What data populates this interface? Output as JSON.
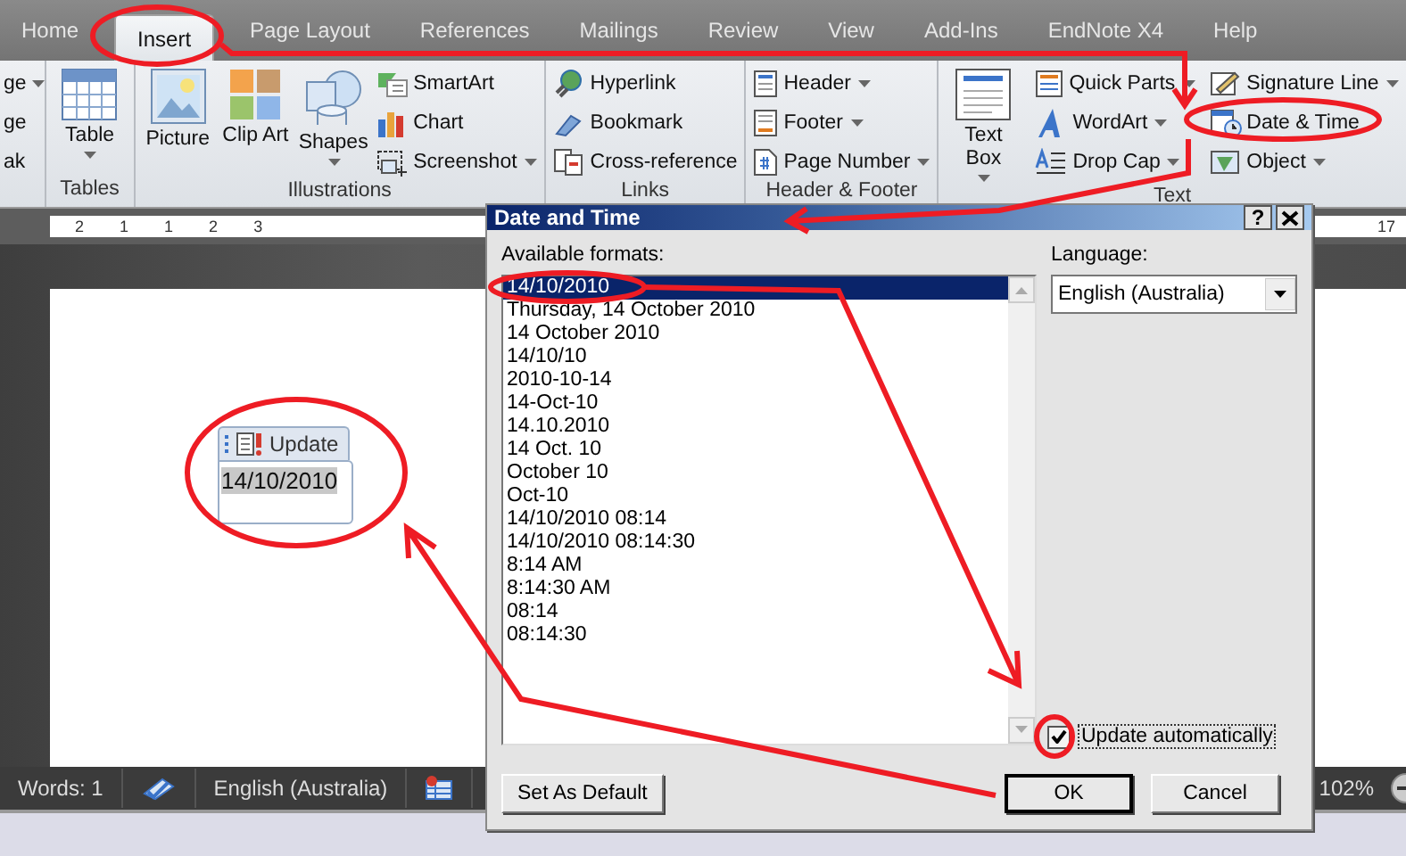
{
  "ribbon_tabs": [
    {
      "label": "Home",
      "selected": false
    },
    {
      "label": "Insert",
      "selected": true
    },
    {
      "label": "Page Layout",
      "selected": false
    },
    {
      "label": "References",
      "selected": false
    },
    {
      "label": "Mailings",
      "selected": false
    },
    {
      "label": "Review",
      "selected": false
    },
    {
      "label": "View",
      "selected": false
    },
    {
      "label": "Add-Ins",
      "selected": false
    },
    {
      "label": "EndNote X4",
      "selected": false
    },
    {
      "label": "Help",
      "selected": false
    }
  ],
  "ribbon_groups": [
    {
      "items": [
        {
          "kind": "column",
          "items": [
            {
              "label": "ge",
              "dropdown": true
            },
            {
              "label": "ge",
              "dropdown": false
            },
            {
              "label": "ak",
              "dropdown": false
            }
          ]
        }
      ]
    },
    {
      "label": "Tables",
      "items": [
        {
          "kind": "large",
          "label": "Table",
          "dropdown": true
        }
      ]
    },
    {
      "label": "Illustrations",
      "items": [
        {
          "kind": "large",
          "label": "Picture",
          "dropdown": false
        },
        {
          "kind": "large",
          "label": "Clip Art",
          "dropdown": false
        },
        {
          "kind": "large",
          "label": "Shapes",
          "dropdown": true
        },
        {
          "kind": "column",
          "items": [
            {
              "label": "SmartArt",
              "dropdown": false
            },
            {
              "label": "Chart",
              "dropdown": false
            },
            {
              "label": "Screenshot",
              "dropdown": true
            }
          ]
        }
      ]
    },
    {
      "label": "Links",
      "items": [
        {
          "kind": "column",
          "items": [
            {
              "label": "Hyperlink",
              "dropdown": false
            },
            {
              "label": "Bookmark",
              "dropdown": false
            },
            {
              "label": "Cross-reference",
              "dropdown": false
            }
          ]
        }
      ]
    },
    {
      "label": "Header & Footer",
      "items": [
        {
          "kind": "column",
          "items": [
            {
              "label": "Header",
              "dropdown": true
            },
            {
              "label": "Footer",
              "dropdown": true
            },
            {
              "label": "Page Number",
              "dropdown": true
            }
          ]
        }
      ]
    },
    {
      "label": "Text",
      "items": [
        {
          "kind": "large",
          "label": "Text Box",
          "dropdown": true
        },
        {
          "kind": "column",
          "items": [
            {
              "label": "Quick Parts",
              "dropdown": true
            },
            {
              "label": "WordArt",
              "dropdown": true
            },
            {
              "label": "Drop Cap",
              "dropdown": true
            }
          ]
        },
        {
          "kind": "column",
          "items": [
            {
              "label": "Signature Line",
              "dropdown": true
            },
            {
              "label": "Date & Time",
              "dropdown": false
            },
            {
              "label": "Object",
              "dropdown": true
            }
          ]
        }
      ]
    }
  ],
  "ruler": {
    "left_numbers": [
      "2",
      "1",
      "1",
      "2",
      "3"
    ],
    "right_number": "17"
  },
  "document": {
    "field": {
      "update_label": "Update",
      "value": "14/10/2010"
    }
  },
  "status_bar": {
    "words": "Words: 1",
    "language": "English (Australia)",
    "zoom": "102%"
  },
  "dialog": {
    "title": "Date and Time",
    "help": "?",
    "formats_label": "Available formats:",
    "formats": [
      {
        "label": "14/10/2010",
        "selected": true
      },
      {
        "label": "Thursday, 14 October 2010",
        "selected": false
      },
      {
        "label": "14 October 2010",
        "selected": false
      },
      {
        "label": "14/10/10",
        "selected": false
      },
      {
        "label": "2010-10-14",
        "selected": false
      },
      {
        "label": "14-Oct-10",
        "selected": false
      },
      {
        "label": "14.10.2010",
        "selected": false
      },
      {
        "label": "14 Oct. 10",
        "selected": false
      },
      {
        "label": "October 10",
        "selected": false
      },
      {
        "label": "Oct-10",
        "selected": false
      },
      {
        "label": "14/10/2010 08:14",
        "selected": false
      },
      {
        "label": "14/10/2010 08:14:30",
        "selected": false
      },
      {
        "label": "8:14 AM",
        "selected": false
      },
      {
        "label": "8:14:30 AM",
        "selected": false
      },
      {
        "label": "08:14",
        "selected": false
      },
      {
        "label": "08:14:30",
        "selected": false
      }
    ],
    "language_label": "Language:",
    "language": "English (Australia)",
    "update_automatically": {
      "label": "Update automatically",
      "checked": true
    },
    "buttons": [
      {
        "label": "Set As Default",
        "default": false
      },
      {
        "label": "OK",
        "default": true
      },
      {
        "label": "Cancel",
        "default": false
      }
    ]
  }
}
